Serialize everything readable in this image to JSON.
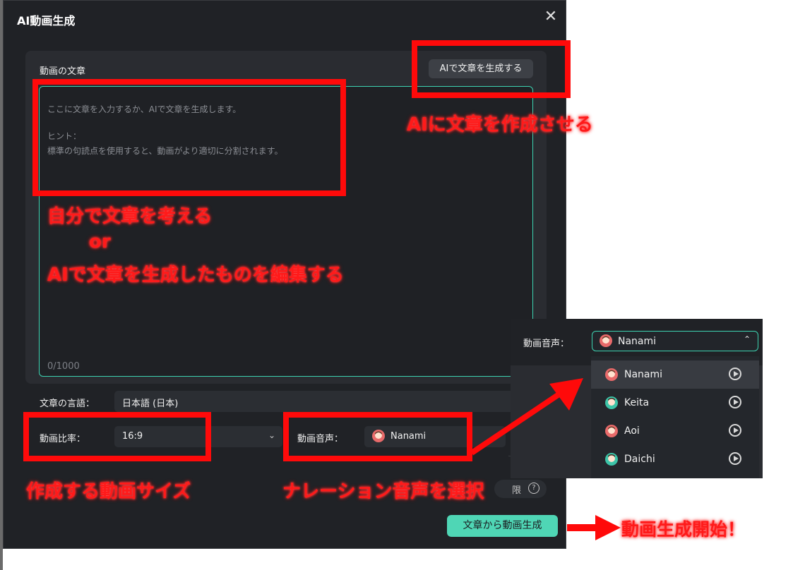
{
  "dialog": {
    "title": "AI動画生成",
    "close_icon": "close-icon"
  },
  "text_panel": {
    "label": "動画の文章",
    "ai_button_label": "AIで文章を生成する",
    "placeholder_line1": "ここに文章を入力するか、AIで文章を生成します。",
    "placeholder_line2": "ヒント：",
    "placeholder_line3": "標準の句読点を使用すると、動画がより適切に分割されます。",
    "counter": "0/1000"
  },
  "settings": {
    "language_label": "文章の言語：",
    "language_value": "日本語 (日本)",
    "ratio_label": "動画比率：",
    "ratio_value": "16:9",
    "voice_label": "動画音声：",
    "voice_value": "Nanami",
    "limit_text": "限",
    "generate_button_label": "文章から動画生成"
  },
  "voice_popup": {
    "label": "動画音声：",
    "selected": "Nanami",
    "options": [
      {
        "name": "Nanami",
        "avatar_color": "#e86a6a",
        "selected": true
      },
      {
        "name": "Keita",
        "avatar_color": "#3cc4a8",
        "selected": false
      },
      {
        "name": "Aoi",
        "avatar_color": "#e86a6a",
        "selected": false
      },
      {
        "name": "Daichi",
        "avatar_color": "#3cc4a8",
        "selected": false
      }
    ]
  },
  "annotations": {
    "ai_create": "AIに文章を作成させる",
    "self_write": "自分で文章を考える",
    "or": "or",
    "ai_edit": "AIで文章を生成したものを編集する",
    "size": "作成する動画サイズ",
    "narration": "ナレーション音声を選択",
    "start": "動画生成開始！"
  },
  "colors": {
    "accent": "#4fd6b5",
    "annotation_red": "#ff0a0a",
    "dialog_bg": "#202226"
  }
}
